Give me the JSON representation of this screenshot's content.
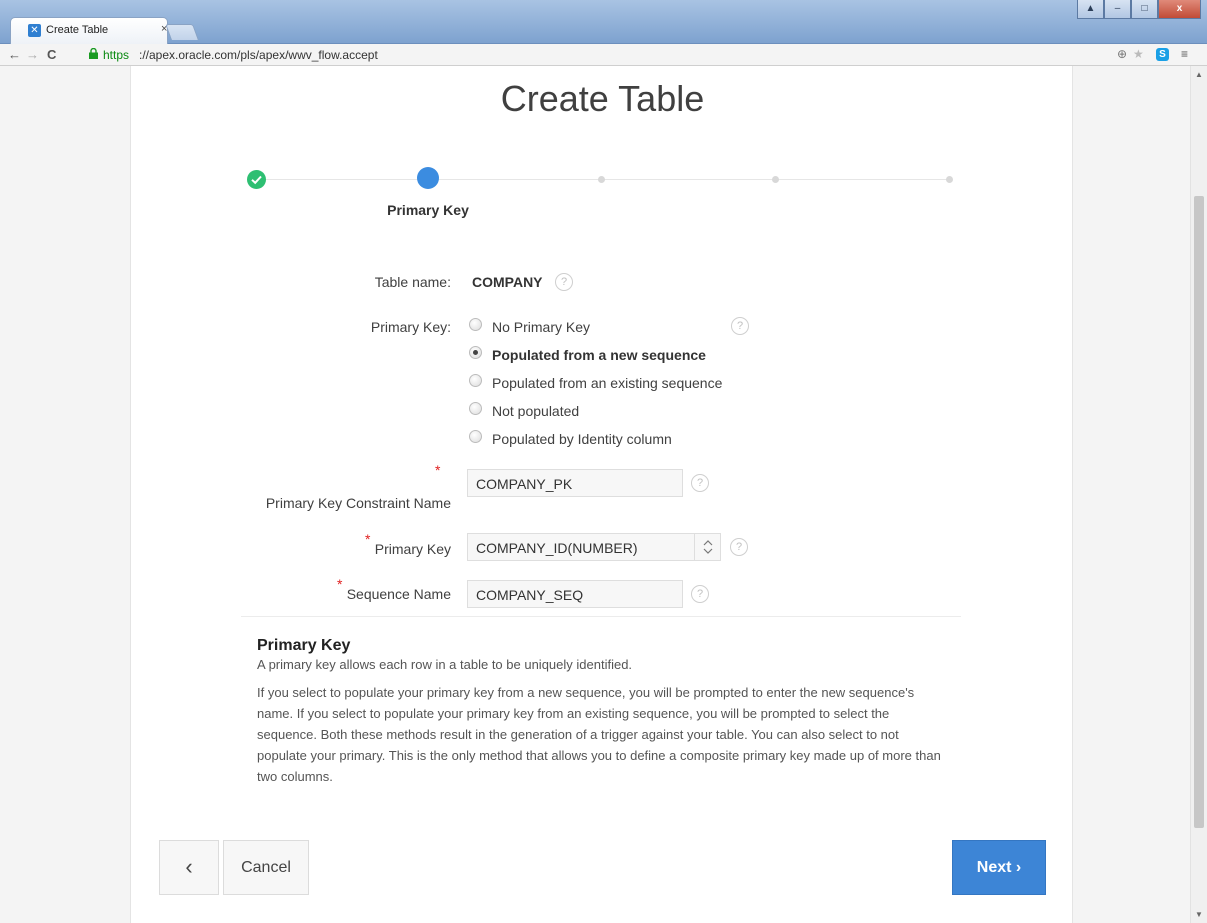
{
  "browser": {
    "tab_title": "Create Table",
    "tab_close": "×",
    "url_https": "https",
    "url_rest": "://apex.oracle.com/pls/apex/wwv_flow.accept"
  },
  "page": {
    "title": "Create Table",
    "wizard": {
      "current_step_label": "Primary Key",
      "total_steps": 5,
      "current_step": 2
    },
    "fields": {
      "table_name_label": "Table name:",
      "table_name_value": "COMPANY",
      "primary_key_label": "Primary Key:",
      "primary_key_options": [
        "No Primary Key",
        "Populated from a new sequence",
        "Populated from an existing sequence",
        "Not populated",
        "Populated by Identity column"
      ],
      "primary_key_selected": "Populated from a new sequence",
      "constraint_name_label": "Primary Key Constraint Name",
      "constraint_name_value": "COMPANY_PK",
      "pk_column_label": "Primary Key",
      "pk_column_value": "COMPANY_ID(NUMBER)",
      "sequence_name_label": "Sequence Name",
      "sequence_name_value": "COMPANY_SEQ",
      "required_marker": "*",
      "help_glyph": "?"
    },
    "help": {
      "title": "Primary Key",
      "subtitle": "A primary key allows each row in a table to be uniquely identified.",
      "body": "If you select to populate your primary key from a new sequence, you will be prompted to enter the new sequence's name. If you select to populate your primary key from an existing sequence, you will be prompted to select the sequence. Both these methods result in the generation of a trigger against your table. You can also select to not populate your primary. This is the only method that allows you to define a composite primary key made up of more than two columns."
    },
    "buttons": {
      "back": "‹",
      "cancel": "Cancel",
      "next": "Next ›"
    }
  },
  "colors": {
    "accent": "#3d85d6",
    "step_done": "#2ebf72",
    "required": "#e02020"
  }
}
